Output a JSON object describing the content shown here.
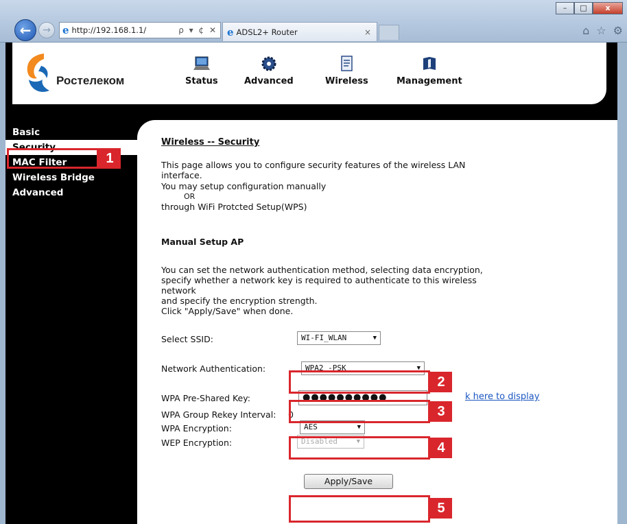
{
  "browser": {
    "address": "http://192.168.1.1/",
    "address_tools": "ρ ▾ ¢ ✕",
    "tab_title": "ADSL2+ Router",
    "tab_close": "×",
    "window_buttons": {
      "minimize": "–",
      "maximize": "□",
      "close": "x"
    },
    "back": "←",
    "forward": "→",
    "home_icon": "⌂",
    "favorites_icon": "☆",
    "tools_icon": "⚙"
  },
  "header": {
    "brand": "Ростелеком",
    "nav": [
      {
        "label": "Status",
        "icon": "laptop-icon"
      },
      {
        "label": "Advanced",
        "icon": "gear-icon"
      },
      {
        "label": "Wireless",
        "icon": "document-icon"
      },
      {
        "label": "Management",
        "icon": "book-icon"
      }
    ]
  },
  "sidebar": {
    "items": [
      "Basic",
      "Security",
      "MAC Filter",
      "Wireless Bridge",
      "Advanced"
    ],
    "active": "Security"
  },
  "content": {
    "title": "Wireless -- Security",
    "intro1": "This page allows you to configure security features of the wireless LAN",
    "intro2": "interface.",
    "intro3": "You may setup configuration manually",
    "intro4": "OR",
    "intro5": "through WiFi Protcted Setup(WPS)",
    "section": "Manual Setup AP",
    "desc1": "You can set the network authentication method, selecting data encryption,",
    "desc2": "specify whether a network key is required to authenticate to this wireless",
    "desc3": "network",
    "desc4": "and specify the encryption strength.",
    "desc5": "Click \"Apply/Save\" when done.",
    "fields": {
      "ssid_label": "Select SSID:",
      "ssid_value": "WI-FI_WLAN",
      "auth_label": "Network Authentication:",
      "auth_value": "WPA2 -PSK",
      "psk_label": "WPA Pre-Shared Key:",
      "psk_value": "●●●●●●●●●●",
      "psk_link": "k here to display",
      "rekey_label": "WPA Group Rekey Interval:",
      "rekey_value": "0",
      "enc_label": "WPA Encryption:",
      "enc_value": "AES",
      "wep_label": "WEP Encryption:",
      "wep_value": "Disabled"
    },
    "apply_button": "Apply/Save"
  },
  "annotations": [
    "1",
    "2",
    "3",
    "4",
    "5"
  ],
  "colors": {
    "highlight": "#d9262c",
    "brand_orange": "#f28a1e",
    "brand_blue": "#1b69b6",
    "link": "#1a55c0"
  }
}
